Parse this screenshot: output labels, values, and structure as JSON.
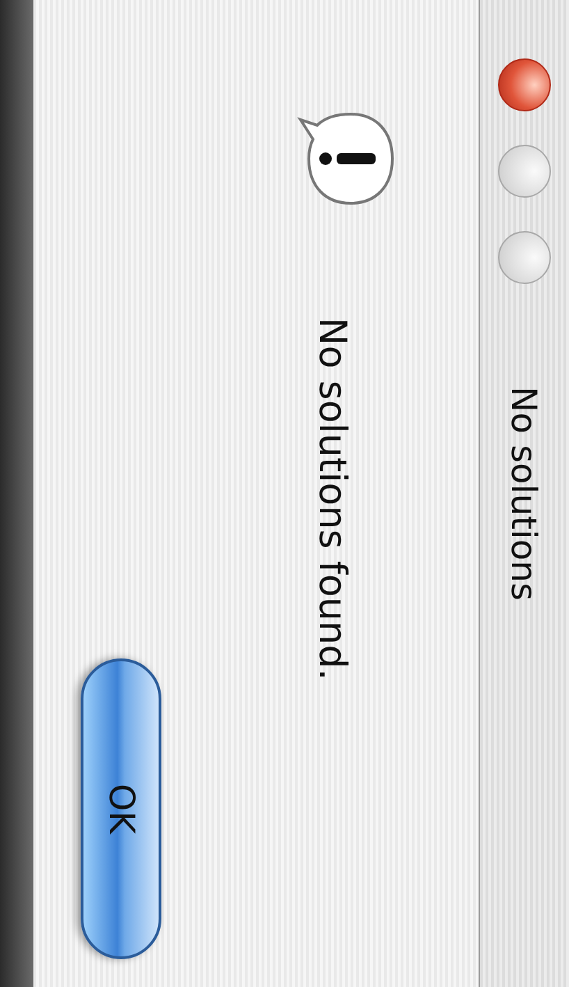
{
  "window": {
    "title": "No solutions"
  },
  "window_controls": [
    {
      "kind": "close",
      "disabled": false
    },
    {
      "kind": "minimize",
      "disabled": true
    },
    {
      "kind": "zoom",
      "disabled": true
    }
  ],
  "alert": {
    "message": "No solutions found."
  },
  "buttons": [
    {
      "label": "OK",
      "default": true
    }
  ]
}
